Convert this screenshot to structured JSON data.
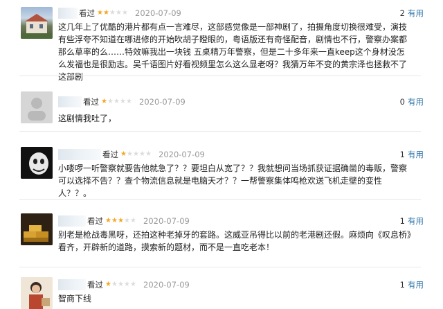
{
  "reviews": [
    {
      "status": "看过",
      "rating": 2,
      "date": "2020-07-09",
      "helpful_count": "2",
      "helpful_label": "有用",
      "content": "这几年上了优酷的港片都有点一言难尽，这部感觉像是一部神剧了，拍摄角度切换很难受，演技有些浮夸不知道在哪进修的开始吹胡子瞪眼的，粤语版还有奇怪配音，剧情也不行，警察办案都那么草率的么……特效嘛我出一块钱 五桌精万年警察，但是二十多年来一直keep这个身材没怎么发福也是很励志。吴千语图片好看视频里怎么这么显老呀？我猜万年不变的黄宗泽也拯救不了这部剧"
    },
    {
      "status": "看过",
      "rating": 1,
      "date": "2020-07-09",
      "helpful_count": "0",
      "helpful_label": "有用",
      "content": "这剧情我吐了，"
    },
    {
      "status": "看过",
      "rating": 1,
      "date": "2020-07-09",
      "helpful_count": "1",
      "helpful_label": "有用",
      "content": "小喽啰一听警察就要告他就急了？？要坦白从宽了？？我就想问当场抓获证据确凿的毒贩，警察可以选择不告？？查个物流信息就是电脑天才？？一帮警察集体鸣枪欢送飞机走壁的变性人？？。"
    },
    {
      "status": "看过",
      "rating": 3,
      "date": "2020-07-09",
      "helpful_count": "1",
      "helpful_label": "有用",
      "content": "别老是枪战毒黑呀，还拍这种老掉牙的套路。这威亚吊得比以前的老港剧还假。麻烦向《叹息桥》看齐，开辟新的道路，摸索新的题材，而不是一直吃老本！"
    },
    {
      "status": "看过",
      "rating": 1,
      "date": "2020-07-09",
      "helpful_count": "1",
      "helpful_label": "有用",
      "content": "智商下线"
    }
  ],
  "colors": {
    "star": "#f5a623",
    "link": "#3377aa",
    "date": "#999999"
  }
}
